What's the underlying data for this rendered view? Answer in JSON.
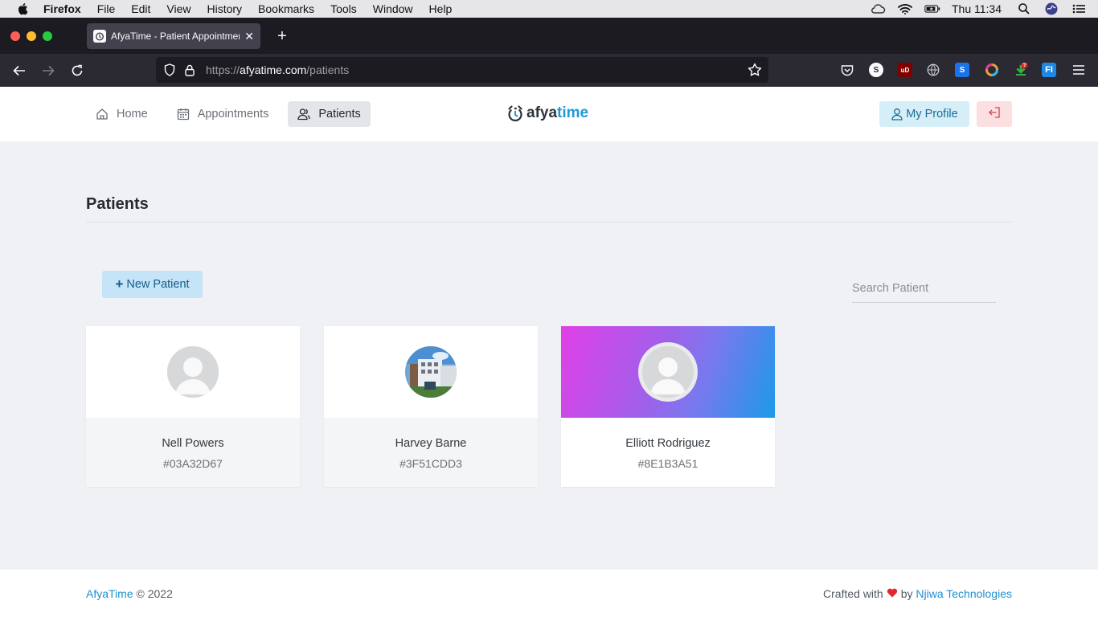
{
  "menubar": {
    "app_name": "Firefox",
    "items": [
      "File",
      "Edit",
      "View",
      "History",
      "Bookmarks",
      "Tools",
      "Window",
      "Help"
    ],
    "clock": "Thu 11:34"
  },
  "browser": {
    "tab_title": "AfyaTime - Patient Appointment",
    "url_scheme": "https://",
    "url_host": "afyatime.com",
    "url_path": "/patients",
    "extension_badge": "?"
  },
  "header": {
    "nav": [
      {
        "label": "Home",
        "icon": "home-icon"
      },
      {
        "label": "Appointments",
        "icon": "calendar-icon"
      },
      {
        "label": "Patients",
        "icon": "users-icon",
        "active": true
      }
    ],
    "brand_afya": "afya",
    "brand_time": "time",
    "profile_label": "My Profile"
  },
  "main": {
    "title": "Patients",
    "new_button_label": "New Patient",
    "search_placeholder": "Search Patient",
    "patients": [
      {
        "name": "Nell Powers",
        "id": "#03A32D67",
        "avatar": "placeholder"
      },
      {
        "name": "Harvey Barne",
        "id": "#3F51CDD3",
        "avatar": "photo"
      },
      {
        "name": "Elliott Rodriguez",
        "id": "#8E1B3A51",
        "avatar": "placeholder",
        "cover": "gradient"
      }
    ]
  },
  "footer": {
    "brand": "AfyaTime",
    "copyright": "© 2022",
    "crafted": "Crafted with",
    "by": "by",
    "company": "Njiwa Technologies"
  },
  "colors": {
    "accent": "#1e9ad9",
    "background": "#eff1f4",
    "heart": "#e3262b"
  }
}
